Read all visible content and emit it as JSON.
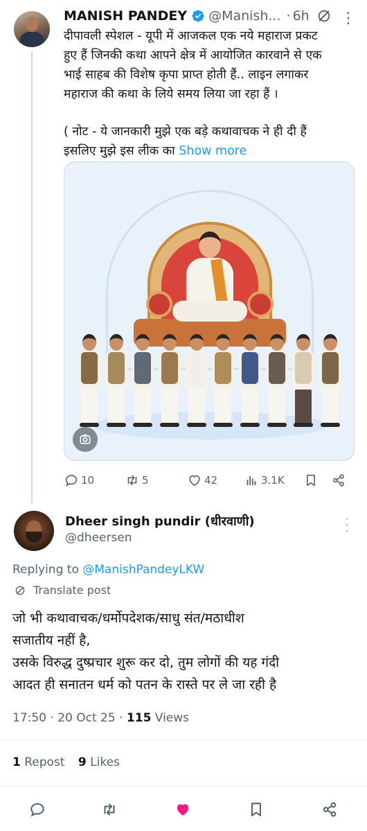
{
  "tweet": {
    "author_name": "MANISH PANDEY",
    "author_handle": "@Manish...",
    "separator": "·",
    "time": "6h",
    "lines": [
      "दीपावली स्पेशल - यूपी में आजकल एक नये  महाराज प्रकट",
      "हुए हैं जिनकी कथा आपने क्षेत्र में आयोजित कारवाने से एक",
      "भाई साहब की विशेष कृपा प्राप्त होती हैं.. लाइन लगाकर",
      "महाराज की कथा के लिये समय लिया जा रहा हैं ।",
      "( नोट - ये जानकारी मुझे एक बड़े कथावाचक ने ही दी हैं",
      "इसलिए मुझे इस लीक का "
    ],
    "show_more": "Show more",
    "replies": "10",
    "reposts": "5",
    "likes": "42",
    "views": "3.1K"
  },
  "reply": {
    "author_name": "Dheer singh pundir (धीरवाणी)",
    "author_handle": "@dheersen",
    "replying_to_label": "Replying to ",
    "replying_to_handle": "@ManishPandeyLKW",
    "translate_label": "Translate post",
    "lines": [
      "जो भी कथावाचक/धर्मोपदेशक/साधु संत/मठाधीश",
      "सजातीय नहीं है,",
      "उसके विरुद्ध दुष्प्रचार शुरू कर दो, तुम लोगों की यह गंदी",
      "आदत ही सनातन धर्म को पतन के रास्ते पर ले जा रही है"
    ],
    "time": "17:50",
    "date": "20 Oct 25",
    "separator": "·",
    "views_count": "115",
    "views_label": " Views",
    "repost_count": "1",
    "repost_label": " Repost",
    "like_count": "9",
    "like_label": " Likes"
  },
  "colors": {
    "link": "#1d9bf0",
    "muted": "#536471",
    "verified": "#1d9bf0",
    "like_active": "#f91880"
  },
  "icons": [
    "verified-icon",
    "grok-icon",
    "more-icon",
    "media-badge-icon",
    "reply-icon",
    "repost-icon",
    "like-icon",
    "views-icon",
    "bookmark-icon",
    "share-icon",
    "translate-icon"
  ]
}
